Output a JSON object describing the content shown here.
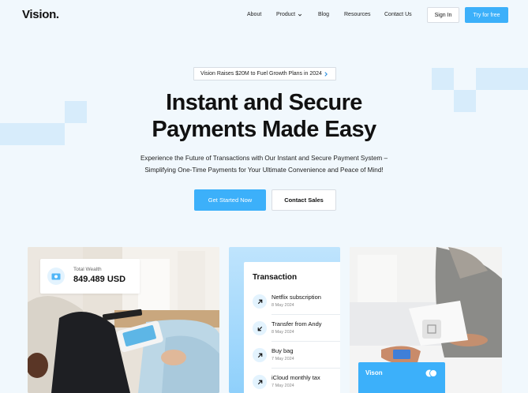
{
  "brand": {
    "logo": "Vision."
  },
  "nav": {
    "items": [
      "About",
      "Product",
      "Blog",
      "Resources",
      "Contact Us"
    ],
    "signin": "Sign In",
    "try_free": "Try for free"
  },
  "announcement": {
    "text": "Vision Raises $20M to Fuel Growth Plans in 2024"
  },
  "hero": {
    "title_line1": "Instant and Secure",
    "title_line2": "Payments Made Easy",
    "subtitle_line1": "Experience the Future of Transactions with Our Instant and Secure Payment System –",
    "subtitle_line2": "Simplifying One-Time Payments for Your Ultimate Convenience and Peace of Mind!",
    "cta_primary": "Get Started Now",
    "cta_secondary": "Contact Sales"
  },
  "wealth": {
    "label": "Total Wealth",
    "value": "849.489 USD",
    "icon": "money-icon"
  },
  "transactions": {
    "title": "Transaction",
    "items": [
      {
        "name": "Netflix subscription",
        "date": "8 May 2024",
        "direction": "out"
      },
      {
        "name": "Transfer from Andy",
        "date": "8 May 2024",
        "direction": "in"
      },
      {
        "name": "Buy bag",
        "date": "7 May 2024",
        "direction": "out"
      },
      {
        "name": "iCloud monthly tax",
        "date": "7 May 2024",
        "direction": "out"
      }
    ]
  },
  "card": {
    "label": "Vison"
  },
  "colors": {
    "accent": "#3cb0fa",
    "background": "#f1f8fd",
    "decor": "#d7ecfb"
  }
}
